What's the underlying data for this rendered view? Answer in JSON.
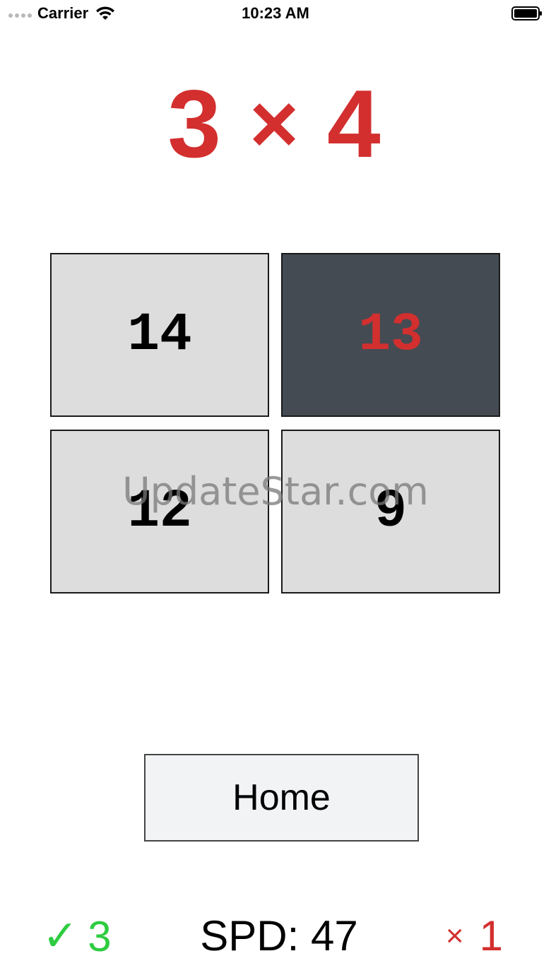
{
  "status_bar": {
    "carrier": "Carrier",
    "time": "10:23 AM",
    "icons": [
      "signal-dots-icon",
      "wifi-icon",
      "battery-icon"
    ]
  },
  "problem": {
    "left": "3",
    "operator": "×",
    "right": "4",
    "color": "#d32f2f"
  },
  "answers": [
    {
      "value": "14",
      "selected": false
    },
    {
      "value": "13",
      "selected": true
    },
    {
      "value": "12",
      "selected": false
    },
    {
      "value": "9",
      "selected": false
    }
  ],
  "watermark": "UpdateStar.com",
  "home_button": {
    "label": "Home"
  },
  "score": {
    "correct_icon": "check-icon",
    "correct_symbol": "✓",
    "correct_count": "3",
    "speed_label": "SPD: 47",
    "wrong_icon": "cross-icon",
    "wrong_symbol": "×",
    "wrong_count": "1",
    "correct_color": "#2ecc40",
    "wrong_color": "#d32f2f"
  }
}
